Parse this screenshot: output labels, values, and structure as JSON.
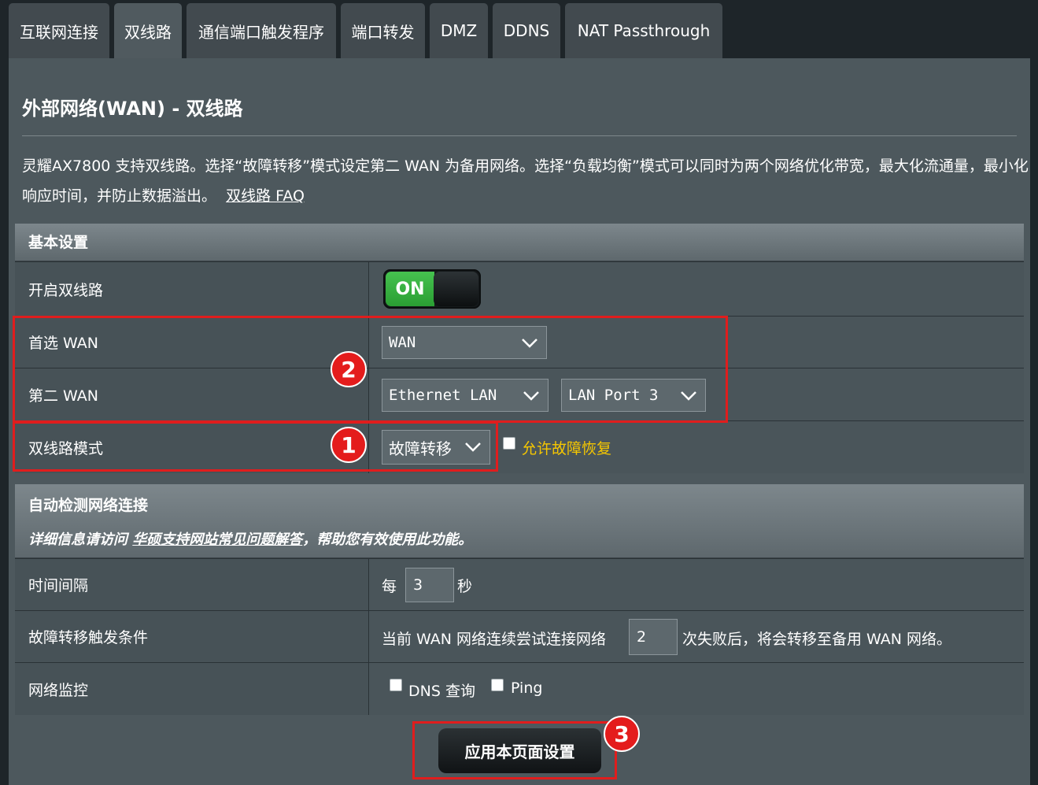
{
  "tabs": [
    "互联网连接",
    "双线路",
    "通信端口触发程序",
    "端口转发",
    "DMZ",
    "DDNS",
    "NAT Passthrough"
  ],
  "page": {
    "title": "外部网络(WAN) - 双线路",
    "description": "灵耀AX7800 支持双线路。选择“故障转移”模式设定第二 WAN 为备用网络。选择“负载均衡”模式可以同时为两个网络优化带宽，最大化流通量，最小化响应时间，并防止数据溢出。",
    "faq_link": "双线路 FAQ"
  },
  "basic": {
    "header": "基本设置",
    "enable_label": "开启双线路",
    "toggle_label": "ON",
    "primary_label": "首选 WAN",
    "primary_value": "WAN",
    "secondary_label": "第二 WAN",
    "secondary_value": "Ethernet LAN",
    "secondary_port": "LAN Port 3",
    "mode_label": "双线路模式",
    "mode_value": "故障转移",
    "allow_failback": "允许故障恢复"
  },
  "detect": {
    "header": "自动检测网络连接",
    "subtitle_prefix": "详细信息请访问 ",
    "subtitle_link": "华硕支持网站常见问题解答",
    "subtitle_suffix": "，帮助您有效使用此功能。",
    "interval_label": "时间间隔",
    "interval_prefix": "每",
    "interval_value": "3",
    "interval_unit": "秒",
    "failover_label": "故障转移触发条件",
    "failover_prefix": "当前 WAN 网络连续尝试连接网络",
    "failover_value": "2",
    "failover_suffix": "次失败后，将会转移至备用 WAN 网络。",
    "monitor_label": "网络监控",
    "monitor_dns": "DNS 查询",
    "monitor_ping": "Ping"
  },
  "apply_button": "应用本页面设置",
  "badges": [
    "1",
    "2",
    "3"
  ],
  "colors": {
    "highlight": "#e01d1d",
    "toggle_on": "#2fa83a",
    "failback_text": "#f6c700"
  }
}
